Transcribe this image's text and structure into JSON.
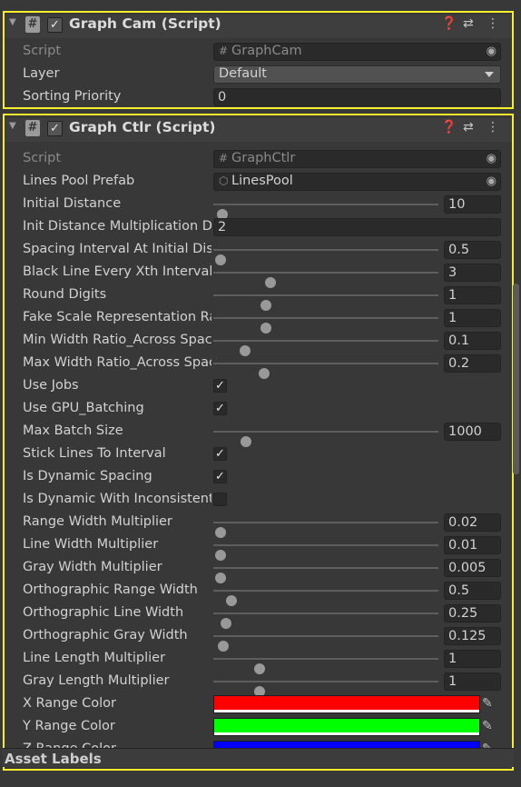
{
  "graph_cam": {
    "title": "Graph Cam (Script)",
    "enabled": true,
    "script_label": "Script",
    "script_value": "GraphCam",
    "layer_label": "Layer",
    "layer_value": "Default",
    "sorting_label": "Sorting Priority",
    "sorting_value": "0"
  },
  "graph_ctlr": {
    "title": "Graph Ctlr (Script)",
    "enabled": true,
    "script_label": "Script",
    "script_value": "GraphCtlr",
    "lines_pool_label": "Lines Pool Prefab",
    "lines_pool_value": "LinesPool",
    "initial_distance": {
      "label": "Initial Distance",
      "value": "10",
      "fraction": 0.01
    },
    "init_distance_mult": {
      "label": "Init Distance Multiplication De",
      "value": "2"
    },
    "spacing_interval": {
      "label": "Spacing Interval At Initial Dist",
      "value": "0.5",
      "fraction": 0.0
    },
    "black_line": {
      "label": "Black Line Every Xth Interval",
      "value": "3",
      "fraction": 0.235
    },
    "round_digits": {
      "label": "Round Digits",
      "value": "1",
      "fraction": 0.215
    },
    "fake_scale": {
      "label": "Fake Scale Representation Ra",
      "value": "1",
      "fraction": 0.215
    },
    "min_width_ratio": {
      "label": "Min Width Ratio_Across Spac",
      "value": "0.1",
      "fraction": 0.115
    },
    "max_width_ratio": {
      "label": "Max Width Ratio_Across Spac",
      "value": "0.2",
      "fraction": 0.205
    },
    "use_jobs": {
      "label": "Use Jobs",
      "checked": true
    },
    "use_gpu": {
      "label": "Use GPU_Batching",
      "checked": true
    },
    "max_batch": {
      "label": "Max Batch Size",
      "value": "1000",
      "fraction": 0.12
    },
    "stick_lines": {
      "label": "Stick Lines To Interval",
      "checked": true
    },
    "is_dynamic_spacing": {
      "label": "Is Dynamic Spacing",
      "checked": true
    },
    "is_dynamic_inconsistent": {
      "label": "Is Dynamic With Inconsistent",
      "checked": false
    },
    "range_width_mult": {
      "label": "Range Width Multiplier",
      "value": "0.02",
      "fraction": 0.0
    },
    "line_width_mult": {
      "label": "Line Width Multiplier",
      "value": "0.01",
      "fraction": 0.0
    },
    "gray_width_mult": {
      "label": "Gray Width Multiplier",
      "value": "0.005",
      "fraction": 0.0
    },
    "ortho_range_width": {
      "label": "Orthographic Range Width",
      "value": "0.5",
      "fraction": 0.05
    },
    "ortho_line_width": {
      "label": "Orthographic Line Width",
      "value": "0.25",
      "fraction": 0.025
    },
    "ortho_gray_width": {
      "label": "Orthographic Gray Width",
      "value": "0.125",
      "fraction": 0.012
    },
    "line_length_mult": {
      "label": "Line Length Multiplier",
      "value": "1",
      "fraction": 0.185
    },
    "gray_length_mult": {
      "label": "Gray Length Multiplier",
      "value": "1",
      "fraction": 0.185
    },
    "x_range_color": {
      "label": "X Range Color",
      "color": "#ff0000"
    },
    "y_range_color": {
      "label": "Y Range Color",
      "color": "#00ff00"
    },
    "z_range_color": {
      "label": "Z Range Color",
      "color": "#0000ff"
    }
  },
  "footer": {
    "asset_labels": "Asset Labels"
  },
  "icons": [
    "foldout-arrow-icon",
    "script-hash-icon",
    "help-icon",
    "preset-sliders-icon",
    "kebab-menu-icon",
    "object-picker-icon",
    "prefab-cube-icon",
    "eyedropper-icon",
    "checkmark-icon"
  ]
}
